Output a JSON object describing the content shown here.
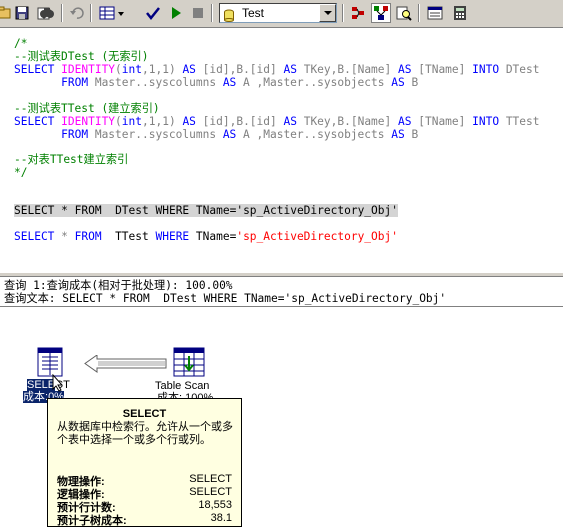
{
  "toolbar": {
    "database": "Test",
    "buttons": [
      "open-icon",
      "save-icon",
      "edit-icon",
      "find-icon",
      "undo-icon",
      "results-grid-icon",
      "check-icon",
      "run-icon",
      "stop-icon",
      "object-browser-icon",
      "show-plan-icon",
      "analyze-icon",
      "properties-icon",
      "calculator-icon"
    ]
  },
  "editor": {
    "l1": "/*",
    "l2": "--测试表DTest (无索引)",
    "l3a": "SELECT ",
    "l3b": "IDENTITY",
    "l3c": "(",
    "l3d": "int",
    "l3e": ",1,1) ",
    "l3f": "AS",
    "l3g": " [id],B.[id] ",
    "l3h": "AS",
    "l3i": " TKey,B.[Name] ",
    "l3j": "AS",
    "l3k": " [TName] ",
    "l3l": "INTO",
    "l3m": " DTest",
    "l4a": "       FROM",
    "l4b": " Master..syscolumns ",
    "l4c": "AS",
    "l4d": " A ,Master..sysobjects ",
    "l4e": "AS",
    "l4f": " B",
    "l5": "--测试表TTest (建立索引)",
    "l6m": " TTest",
    "l7": "--对表TTest建立索引",
    "l8": "*/",
    "q1a": "SELECT",
    "q1b": " * ",
    "q1c": "FROM",
    "q1d": "  DTest ",
    "q1e": "WHERE",
    "q1f": " TName=",
    "q1g": "'sp_ActiveDirectory_Obj'",
    "q2a": "SELECT",
    "q2b": " * ",
    "q2c": "FROM",
    "q2d": "  TTest ",
    "q2e": "WHERE",
    "q2f": " TName=",
    "q2g": "'sp_ActiveDirectory_Obj'"
  },
  "results": {
    "query_cost": "查询 1:查询成本(相对于批处理): 100.00%",
    "query_text": "查询文本: SELECT * FROM  DTest WHERE TName='sp_ActiveDirectory_Obj'",
    "select_node_line1": "SELE",
    "select_node_line1b": "CT",
    "select_node_line2": "成本:",
    "select_node_line2b": "0%",
    "scan_node_line1": "Table Scan",
    "scan_node_line2": "成本: 100%"
  },
  "tooltip": {
    "title": "SELECT",
    "description": "从数据库中检索行。允许从一个或多个表中选择一个或多个行或列。",
    "rows": [
      {
        "label": "物理操作:",
        "value": "SELECT"
      },
      {
        "label": "逻辑操作:",
        "value": "SELECT"
      },
      {
        "label": "预计行计数:",
        "value": "18,553"
      },
      {
        "label": "预计子树成本:",
        "value": "38.1"
      }
    ]
  }
}
